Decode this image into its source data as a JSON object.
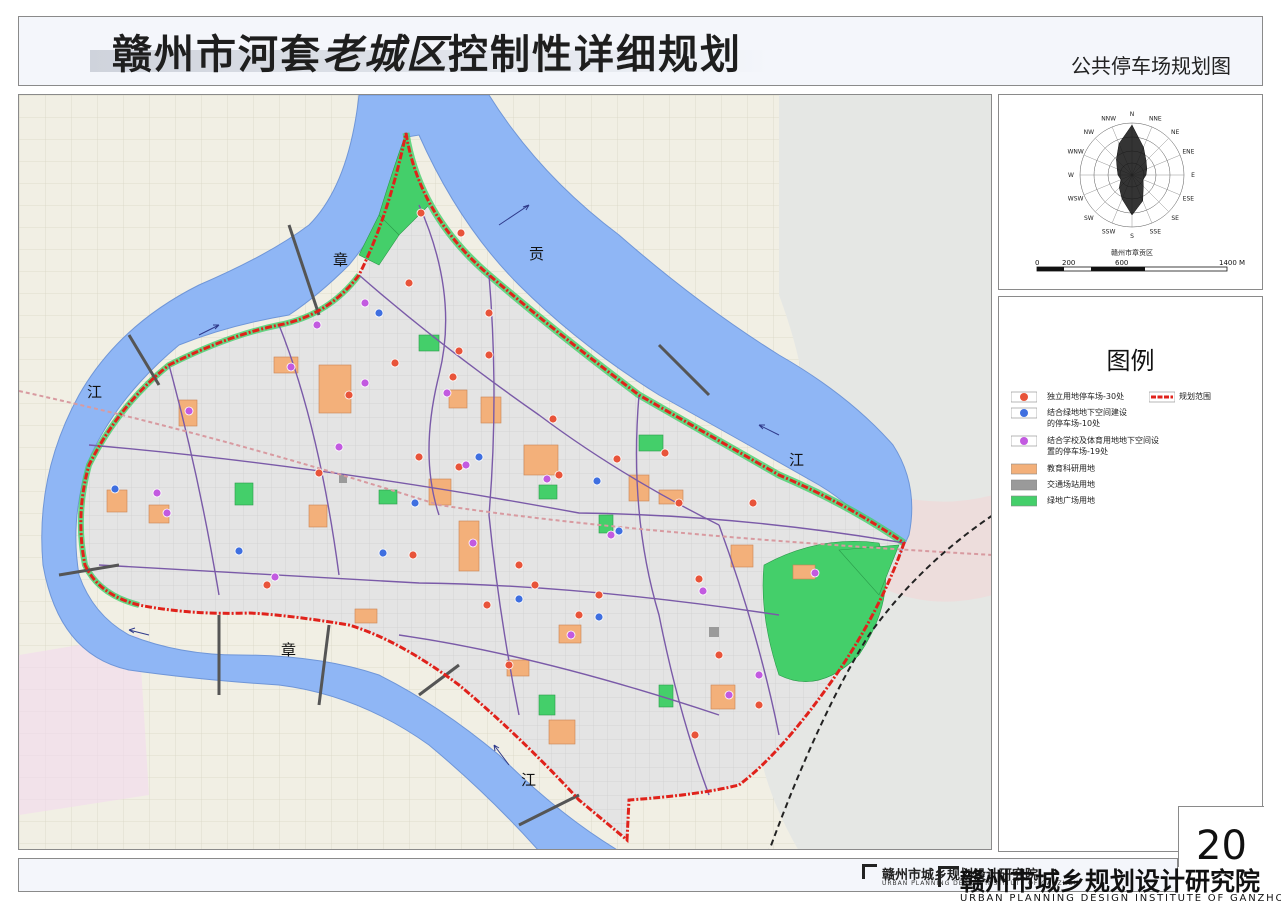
{
  "title": {
    "part1": "赣州市河套",
    "part2": "老城区",
    "part3": "控制性详细规划",
    "subtitle": "公共停车场规划图"
  },
  "compass": {
    "directions": [
      "N",
      "NNE",
      "NE",
      "ENE",
      "E",
      "ESE",
      "SE",
      "SSE",
      "S",
      "SSW",
      "SW",
      "WSW",
      "W",
      "WNW",
      "NW",
      "NNW"
    ],
    "caption": "赣州市章贡区"
  },
  "scale_bar": {
    "ticks": [
      "0",
      "200",
      "600",
      "1400"
    ],
    "unit": "M"
  },
  "legend": {
    "title": "图例",
    "items": [
      {
        "label": "独立用地停车场-30处",
        "symbol": "circle",
        "color": "#e8543a"
      },
      {
        "label": "规划范围",
        "symbol": "boundary-line",
        "color": "#e0221b"
      },
      {
        "label": "结合绿地地下空间建设的停车场-10处",
        "symbol": "circle",
        "color": "#3f6fe0"
      },
      {
        "label": "结合学校及体育用地地下空间设置的停车场-19处",
        "symbol": "circle",
        "color": "#c25ae0"
      },
      {
        "label": "教育科研用地",
        "symbol": "rect",
        "color": "#f3b07a"
      },
      {
        "label": "交通场站用地",
        "symbol": "rect",
        "color": "#9a9a9a"
      },
      {
        "label": "绿地广场用地",
        "symbol": "rect",
        "color": "#44cf6a"
      }
    ]
  },
  "map": {
    "river_labels": [
      {
        "id": "zhang-north",
        "text": "章"
      },
      {
        "id": "gong",
        "text": "贡"
      },
      {
        "id": "jiang-west",
        "text": "江"
      },
      {
        "id": "jiang-east",
        "text": "江"
      },
      {
        "id": "zhang-south",
        "text": "章"
      },
      {
        "id": "jiang-south",
        "text": "江"
      }
    ],
    "colors": {
      "river": "#8fb6f5",
      "land": "#efeee8",
      "urban": "#e6e6e6",
      "road": "#7a5aa8",
      "boundary": "#e0221b"
    }
  },
  "page_number": "20",
  "institute": {
    "name_cn": "赣州市城乡规划设计研究院",
    "name_en": "URBAN PLANNING DESIGN INSTITUTE OF GANZHOU",
    "ghost_cn": "赣州市城乡规划设计研究院",
    "ghost_en": "URBAN PLANNING DESIGN INSTITUTE OF GANZHOU"
  }
}
